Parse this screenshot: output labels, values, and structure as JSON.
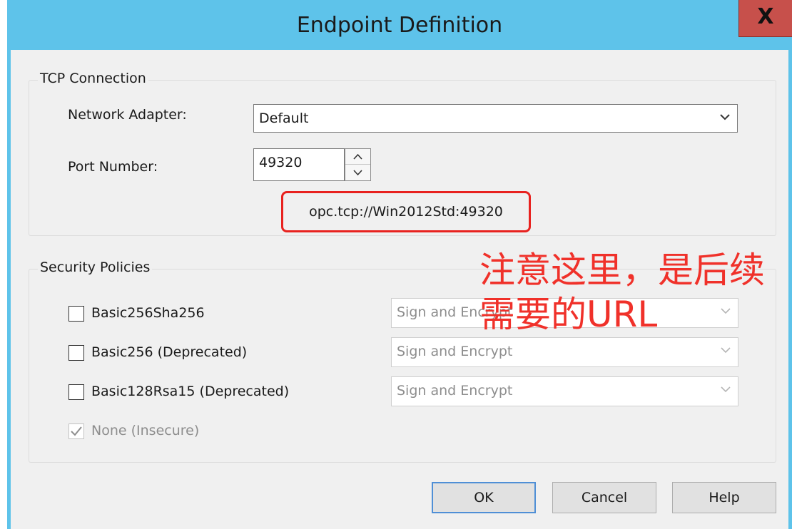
{
  "window": {
    "title": "Endpoint Definition",
    "close_label": "X"
  },
  "tcp": {
    "group_label": "TCP Connection",
    "adapter_label": "Network Adapter:",
    "adapter_value": "Default",
    "port_label": "Port Number:",
    "port_value": "49320",
    "endpoint_url": "opc.tcp://Win2012Std:49320"
  },
  "security": {
    "group_label": "Security Policies",
    "policies": [
      {
        "label": "Basic256Sha256",
        "checked": false,
        "mode": "Sign and Encrypt"
      },
      {
        "label": "Basic256 (Deprecated)",
        "checked": false,
        "mode": "Sign and Encrypt"
      },
      {
        "label": "Basic128Rsa15 (Deprecated)",
        "checked": false,
        "mode": "Sign and Encrypt"
      },
      {
        "label": "None (Insecure)",
        "checked": true,
        "disabled": true
      }
    ]
  },
  "annotation": {
    "line1": "注意这里，是后续",
    "line2": "需要的URL"
  },
  "buttons": {
    "ok": "OK",
    "cancel": "Cancel",
    "help": "Help"
  },
  "colors": {
    "titlebar": "#5ec3ea",
    "close": "#c7504b",
    "highlight": "#e8221f",
    "annotation": "#f0312a"
  }
}
